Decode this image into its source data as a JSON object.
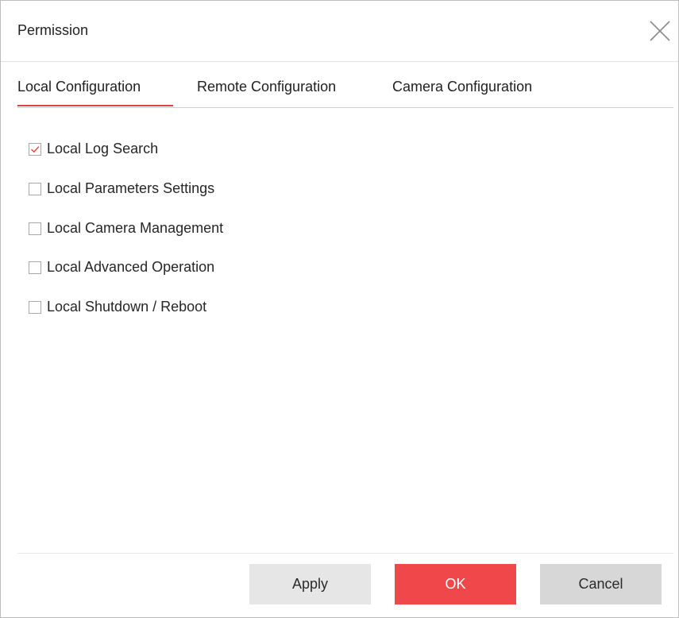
{
  "dialog": {
    "title": "Permission",
    "close_icon": "close-icon"
  },
  "tabs": [
    {
      "label": "Local Configuration",
      "active": true
    },
    {
      "label": "Remote Configuration",
      "active": false
    },
    {
      "label": "Camera Configuration",
      "active": false
    }
  ],
  "permissions": [
    {
      "label": "Local Log Search",
      "checked": true
    },
    {
      "label": "Local Parameters Settings",
      "checked": false
    },
    {
      "label": "Local Camera Management",
      "checked": false
    },
    {
      "label": "Local Advanced Operation",
      "checked": false
    },
    {
      "label": "Local Shutdown / Reboot",
      "checked": false
    }
  ],
  "buttons": {
    "apply": "Apply",
    "ok": "OK",
    "cancel": "Cancel"
  },
  "colors": {
    "accent": "#f0484a",
    "tab_underline": "#e8403e",
    "checkmark": "#e8403e",
    "apply_bg": "#e6e6e6",
    "cancel_bg": "#d7d7d7"
  }
}
